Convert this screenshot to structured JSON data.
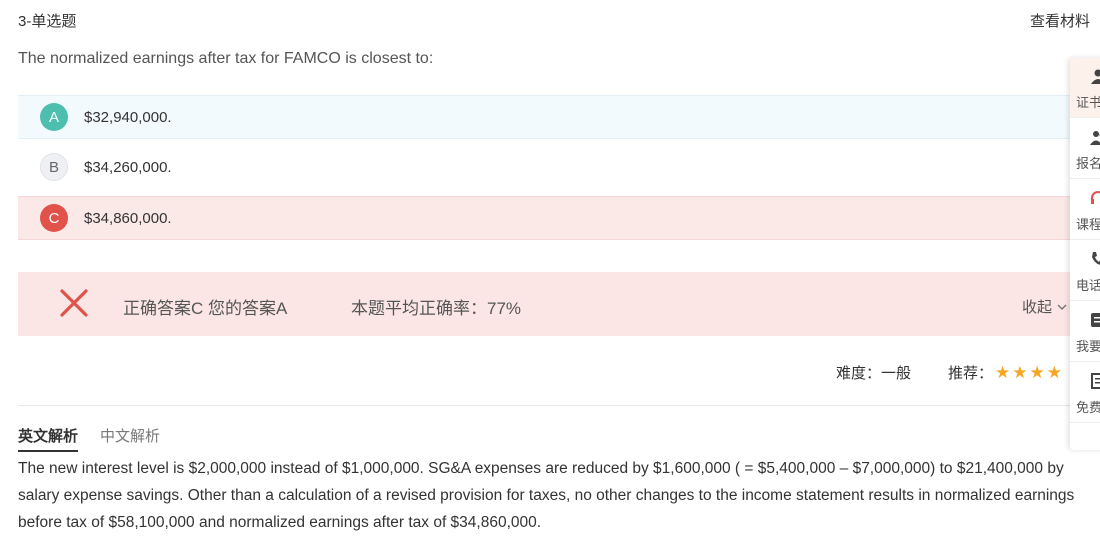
{
  "header": {
    "title": "3-单选题",
    "view_material": "查看材料"
  },
  "question": "The normalized earnings after tax for FAMCO is closest to:",
  "options": [
    {
      "letter": "A",
      "text": "$32,940,000."
    },
    {
      "letter": "B",
      "text": "$34,260,000."
    },
    {
      "letter": "C",
      "text": "$34,860,000."
    }
  ],
  "result": {
    "answer_text": "正确答案C 您的答案A",
    "accuracy_label": "本题平均正确率：",
    "accuracy_value": "77%",
    "collapse_label": "收起"
  },
  "meta": {
    "difficulty": "难度：一般",
    "recommend_label": "推荐：",
    "stars": 4
  },
  "tabs": [
    {
      "label": "英文解析"
    },
    {
      "label": "中文解析"
    }
  ],
  "explanation": "The new interest level is $2,000,000 instead of $1,000,000. SG&A expenses are reduced by $1,600,000 ( = $5,400,000 – $7,000,000) to $21,400,000 by salary expense savings. Other than a calculation of a revised provision for taxes, no other changes to the income statement results in normalized earnings before tax of $58,100,000 and normalized earnings after tax of $34,860,000.",
  "sidebar": {
    "items": [
      {
        "label": "证书",
        "icon": "user-icon"
      },
      {
        "label": "报名",
        "icon": "users-icon"
      },
      {
        "label": "课程",
        "icon": "headset-icon"
      },
      {
        "label": "电话",
        "icon": "phone-icon"
      },
      {
        "label": "我要",
        "icon": "edit-icon"
      },
      {
        "label": "免费",
        "icon": "book-icon"
      }
    ]
  },
  "colors": {
    "correct_green": "#4cbfaf",
    "wrong_red": "#e0524a",
    "wrong_bg": "#fbe6e5",
    "star": "#f5a623"
  }
}
